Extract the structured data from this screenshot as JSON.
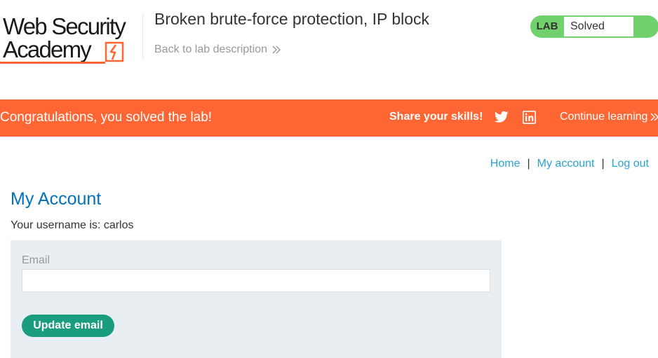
{
  "header": {
    "logo": {
      "line1": "Web Security",
      "line2": "Academy"
    },
    "lab_title": "Broken brute-force protection, IP block",
    "back_link": "Back to lab description",
    "lab_status": {
      "tag": "LAB",
      "value": "Solved",
      "color": "#70d16d"
    }
  },
  "banner": {
    "message": "Congratulations, you solved the lab!",
    "share_label": "Share your skills!",
    "share_icons": [
      "twitter-icon",
      "linkedin-icon"
    ],
    "continue_label": "Continue learning",
    "background": "#ff6633"
  },
  "nav": {
    "items": [
      "Home",
      "My account",
      "Log out"
    ],
    "separator": "|"
  },
  "main": {
    "title": "My Account",
    "username_line": "Your username is: carlos",
    "form": {
      "email_label": "Email",
      "email_value": "",
      "email_placeholder": "",
      "submit_label": "Update email",
      "button_color": "#1a9c7e"
    }
  }
}
